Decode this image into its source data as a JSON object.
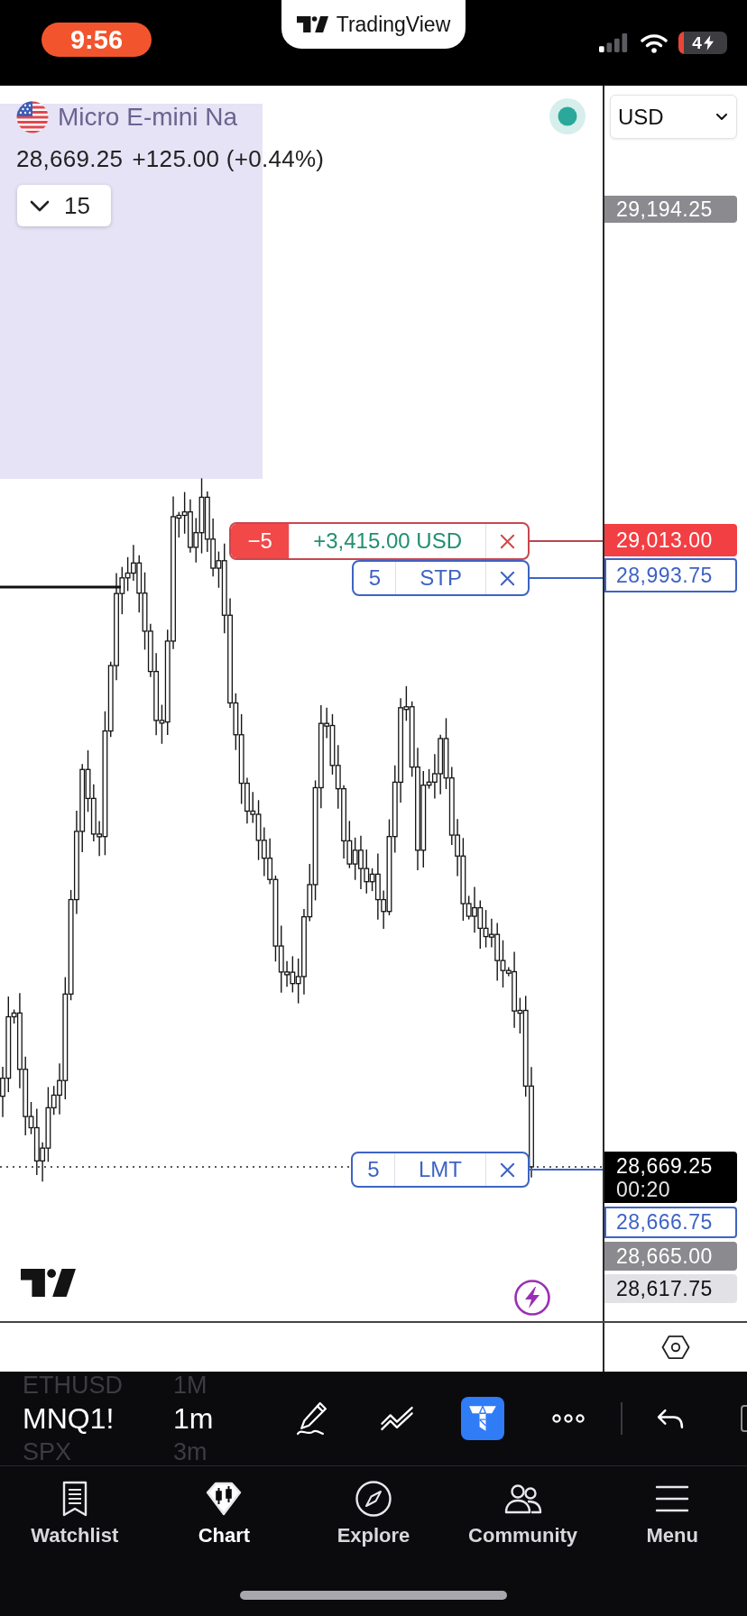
{
  "status_bar": {
    "time": "9:56",
    "battery": "4"
  },
  "app_banner": {
    "name": "TradingView"
  },
  "symbol_header": {
    "title": "Micro E-mini Na",
    "price": "28,669.25",
    "change": "+125.00 (+0.44%)",
    "interval": "15"
  },
  "currency_select": {
    "value": "USD"
  },
  "order_lines": [
    {
      "kind": "position",
      "quantity": "−5",
      "pnl": "+3,415.00 USD"
    },
    {
      "kind": "order",
      "quantity": "5",
      "type": "STP"
    },
    {
      "kind": "order",
      "quantity": "5",
      "type": "LMT"
    }
  ],
  "price_axis": [
    {
      "kind": "high",
      "text": "29,194.25"
    },
    {
      "kind": "position",
      "text": "29,013.00"
    },
    {
      "kind": "order",
      "text": "28,993.75"
    },
    {
      "kind": "last",
      "text": "28,669.25",
      "countdown": "00:20"
    },
    {
      "kind": "order",
      "text": "28,666.75"
    },
    {
      "kind": "bid",
      "text": "28,665.00"
    },
    {
      "kind": "low",
      "text": "28,617.75"
    }
  ],
  "toolbar": {
    "symbols": [
      {
        "symbol": "ETHUSD",
        "interval": "1M",
        "selected": false
      },
      {
        "symbol": "MNQ1!",
        "interval": "1m",
        "selected": true
      },
      {
        "symbol": "SPX",
        "interval": "3m",
        "selected": false
      }
    ],
    "tools": [
      {
        "selected": false
      },
      {
        "selected": false
      },
      {
        "selected": true
      },
      {
        "selected": false
      },
      {
        "selected": false
      }
    ]
  },
  "bottom_nav": [
    {
      "label": "Watchlist",
      "selected": false
    },
    {
      "label": "Chart",
      "selected": true
    },
    {
      "label": "Explore",
      "selected": false
    },
    {
      "label": "Community",
      "selected": false
    },
    {
      "label": "Menu",
      "selected": false
    }
  ]
}
